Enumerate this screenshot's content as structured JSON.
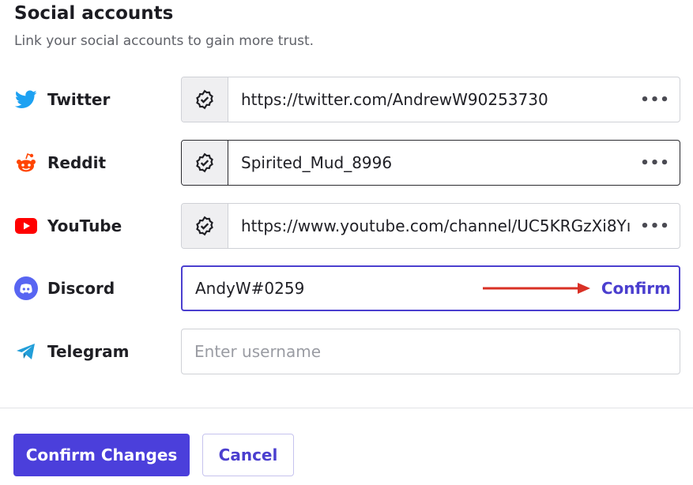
{
  "header": {
    "title": "Social accounts",
    "subtitle": "Link your social accounts to gain more trust."
  },
  "accounts": [
    {
      "platform": "Twitter",
      "icon": "twitter-icon",
      "value": "https://twitter.com/AndrewW90253730",
      "verified": true,
      "more": "•••"
    },
    {
      "platform": "Reddit",
      "icon": "reddit-icon",
      "value": "Spirited_Mud_8996",
      "verified": true,
      "more": "•••"
    },
    {
      "platform": "YouTube",
      "icon": "youtube-icon",
      "value": "https://www.youtube.com/channel/UC5KRGzXi8Yı",
      "verified": true,
      "more": "•••"
    },
    {
      "platform": "Discord",
      "icon": "discord-icon",
      "value": "AndyW#0259",
      "verified": false,
      "action": "Confirm"
    },
    {
      "platform": "Telegram",
      "icon": "telegram-icon",
      "value": "",
      "placeholder": "Enter username",
      "verified": false
    }
  ],
  "footer": {
    "confirm_label": "Confirm Changes",
    "cancel_label": "Cancel"
  },
  "colors": {
    "accent": "#4b3fdb",
    "twitter": "#1da1f2",
    "reddit": "#ff4500",
    "youtube": "#ff0000",
    "discord": "#5865f2",
    "telegram": "#229ed9",
    "arrow": "#d93025"
  }
}
